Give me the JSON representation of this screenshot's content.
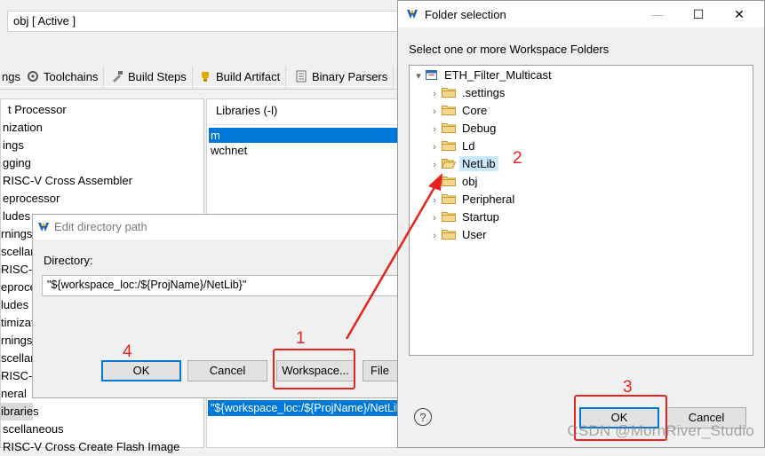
{
  "config": {
    "configuration_value": "obj  [ Active ]",
    "tabs": [
      "ngs",
      "Toolchains",
      "Build Steps",
      "Build Artifact",
      "Binary Parsers"
    ],
    "tree_items": [
      "t Processor",
      "nization",
      "ings",
      "gging",
      "RISC-V Cross Assembler",
      "eprocessor",
      "ludes",
      "rnings",
      "scellan",
      "RISC-V",
      "eprocess",
      "ludes",
      "timizat",
      "rnings",
      "scellan",
      "RISC-V",
      "neral",
      "ibraries",
      "scellaneous",
      "RISC-V Cross Create Flash Image"
    ],
    "libraries": {
      "header": "Libraries (-l)",
      "items": [
        "m",
        "wchnet"
      ]
    },
    "library_paths_selected": "\"${workspace_loc:/${ProjName}/NetLib}\""
  },
  "edit_dialog": {
    "title": "Edit directory path",
    "directory_label": "Directory:",
    "directory_value": "\"${workspace_loc:/${ProjName}/NetLib}\"",
    "ok": "OK",
    "cancel": "Cancel",
    "workspace": "Workspace...",
    "filesystem": "File sy"
  },
  "folder_dialog": {
    "title": "Folder selection",
    "minimize": "—",
    "maximize": "☐",
    "close": "✕",
    "prompt": "Select one or more Workspace Folders",
    "project": "ETH_Filter_Multicast",
    "folders": [
      ".settings",
      "Core",
      "Debug",
      "Ld",
      "NetLib",
      "obj",
      "Peripheral",
      "Startup",
      "User"
    ],
    "selected_folder": "NetLib",
    "help": "?",
    "ok": "OK",
    "cancel": "Cancel"
  },
  "annotations": {
    "step1": "1",
    "step2": "2",
    "step3": "3",
    "step4": "4",
    "color": "#e8231f"
  },
  "watermark": "CSDN @MornRiver_Studio",
  "icons": {
    "app": "wch-logo-icon",
    "folder": "folder-icon",
    "project": "project-icon"
  }
}
